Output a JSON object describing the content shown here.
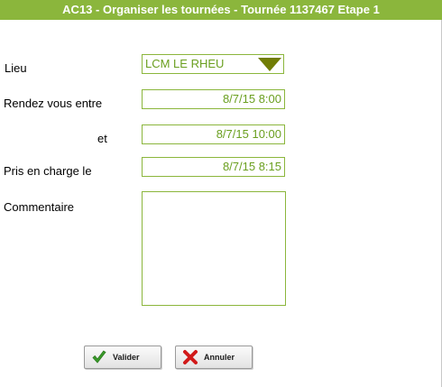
{
  "window": {
    "title": "AC13 - Organiser les tournées - Tournée 1137467 Etape 1"
  },
  "form": {
    "lieu": {
      "label": "Lieu",
      "value": "LCM LE RHEU"
    },
    "rdv_start": {
      "label": "Rendez vous entre",
      "value": "8/7/15 8:00"
    },
    "rdv_end": {
      "label": "et",
      "value": "8/7/15 10:00"
    },
    "prise_en_charge": {
      "label": "Pris en charge le",
      "value": "8/7/15 8:15"
    },
    "commentaire": {
      "label": "Commentaire",
      "value": ""
    }
  },
  "buttons": {
    "valider": {
      "label": "Valider",
      "icon": "green-check-icon"
    },
    "annuler": {
      "label": "Annuler",
      "icon": "red-x-icon"
    }
  },
  "colors": {
    "titlebar": "#8bb63c",
    "field_border": "#8bb63c",
    "field_text": "#6a9f1f",
    "dropdown_arrow": "#717d05"
  }
}
